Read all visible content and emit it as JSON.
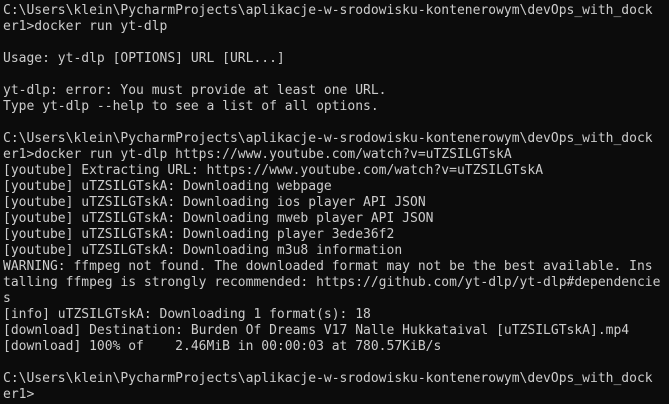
{
  "terminal": {
    "lines": [
      "C:\\Users\\klein\\PycharmProjects\\aplikacje-w-srodowisku-kontenerowym\\devOps_with_dock",
      "er1>docker run yt-dlp",
      "",
      "Usage: yt-dlp [OPTIONS] URL [URL...]",
      "",
      "yt-dlp: error: You must provide at least one URL.",
      "Type yt-dlp --help to see a list of all options.",
      "",
      "C:\\Users\\klein\\PycharmProjects\\aplikacje-w-srodowisku-kontenerowym\\devOps_with_dock",
      "er1>docker run yt-dlp https://www.youtube.com/watch?v=uTZSILGTskA",
      "[youtube] Extracting URL: https://www.youtube.com/watch?v=uTZSILGTskA",
      "[youtube] uTZSILGTskA: Downloading webpage",
      "[youtube] uTZSILGTskA: Downloading ios player API JSON",
      "[youtube] uTZSILGTskA: Downloading mweb player API JSON",
      "[youtube] uTZSILGTskA: Downloading player 3ede36f2",
      "[youtube] uTZSILGTskA: Downloading m3u8 information",
      "WARNING: ffmpeg not found. The downloaded format may not be the best available. Ins",
      "talling ffmpeg is strongly recommended: https://github.com/yt-dlp/yt-dlp#dependencie",
      "s",
      "[info] uTZSILGTskA: Downloading 1 format(s): 18",
      "[download] Destination: Burden Of Dreams V17 Nalle Hukkataival [uTZSILGTskA].mp4",
      "[download] 100% of    2.46MiB in 00:00:03 at 780.57KiB/s",
      "",
      "C:\\Users\\klein\\PycharmProjects\\aplikacje-w-srodowisku-kontenerowym\\devOps_with_dock",
      "er1>"
    ]
  }
}
